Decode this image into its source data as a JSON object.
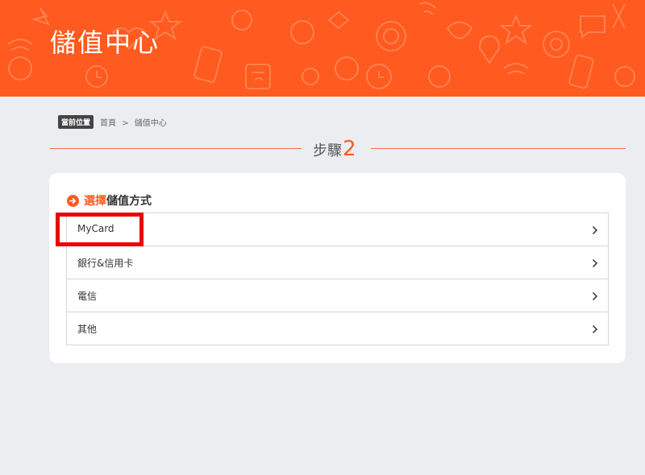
{
  "header": {
    "title": "儲值中心"
  },
  "breadcrumb": {
    "badge": "當前位置",
    "home": "首頁",
    "separator": ">",
    "current": "儲值中心"
  },
  "step": {
    "label": "步驟",
    "number": "2"
  },
  "section": {
    "title_accent": "選擇",
    "title_rest": "儲值方式"
  },
  "methods": [
    {
      "label": "MyCard"
    },
    {
      "label": "銀行&信用卡"
    },
    {
      "label": "電信"
    },
    {
      "label": "其他"
    }
  ],
  "colors": {
    "brand": "#ff5a1f",
    "highlight": "#ee0000",
    "background": "#ebedf1"
  }
}
